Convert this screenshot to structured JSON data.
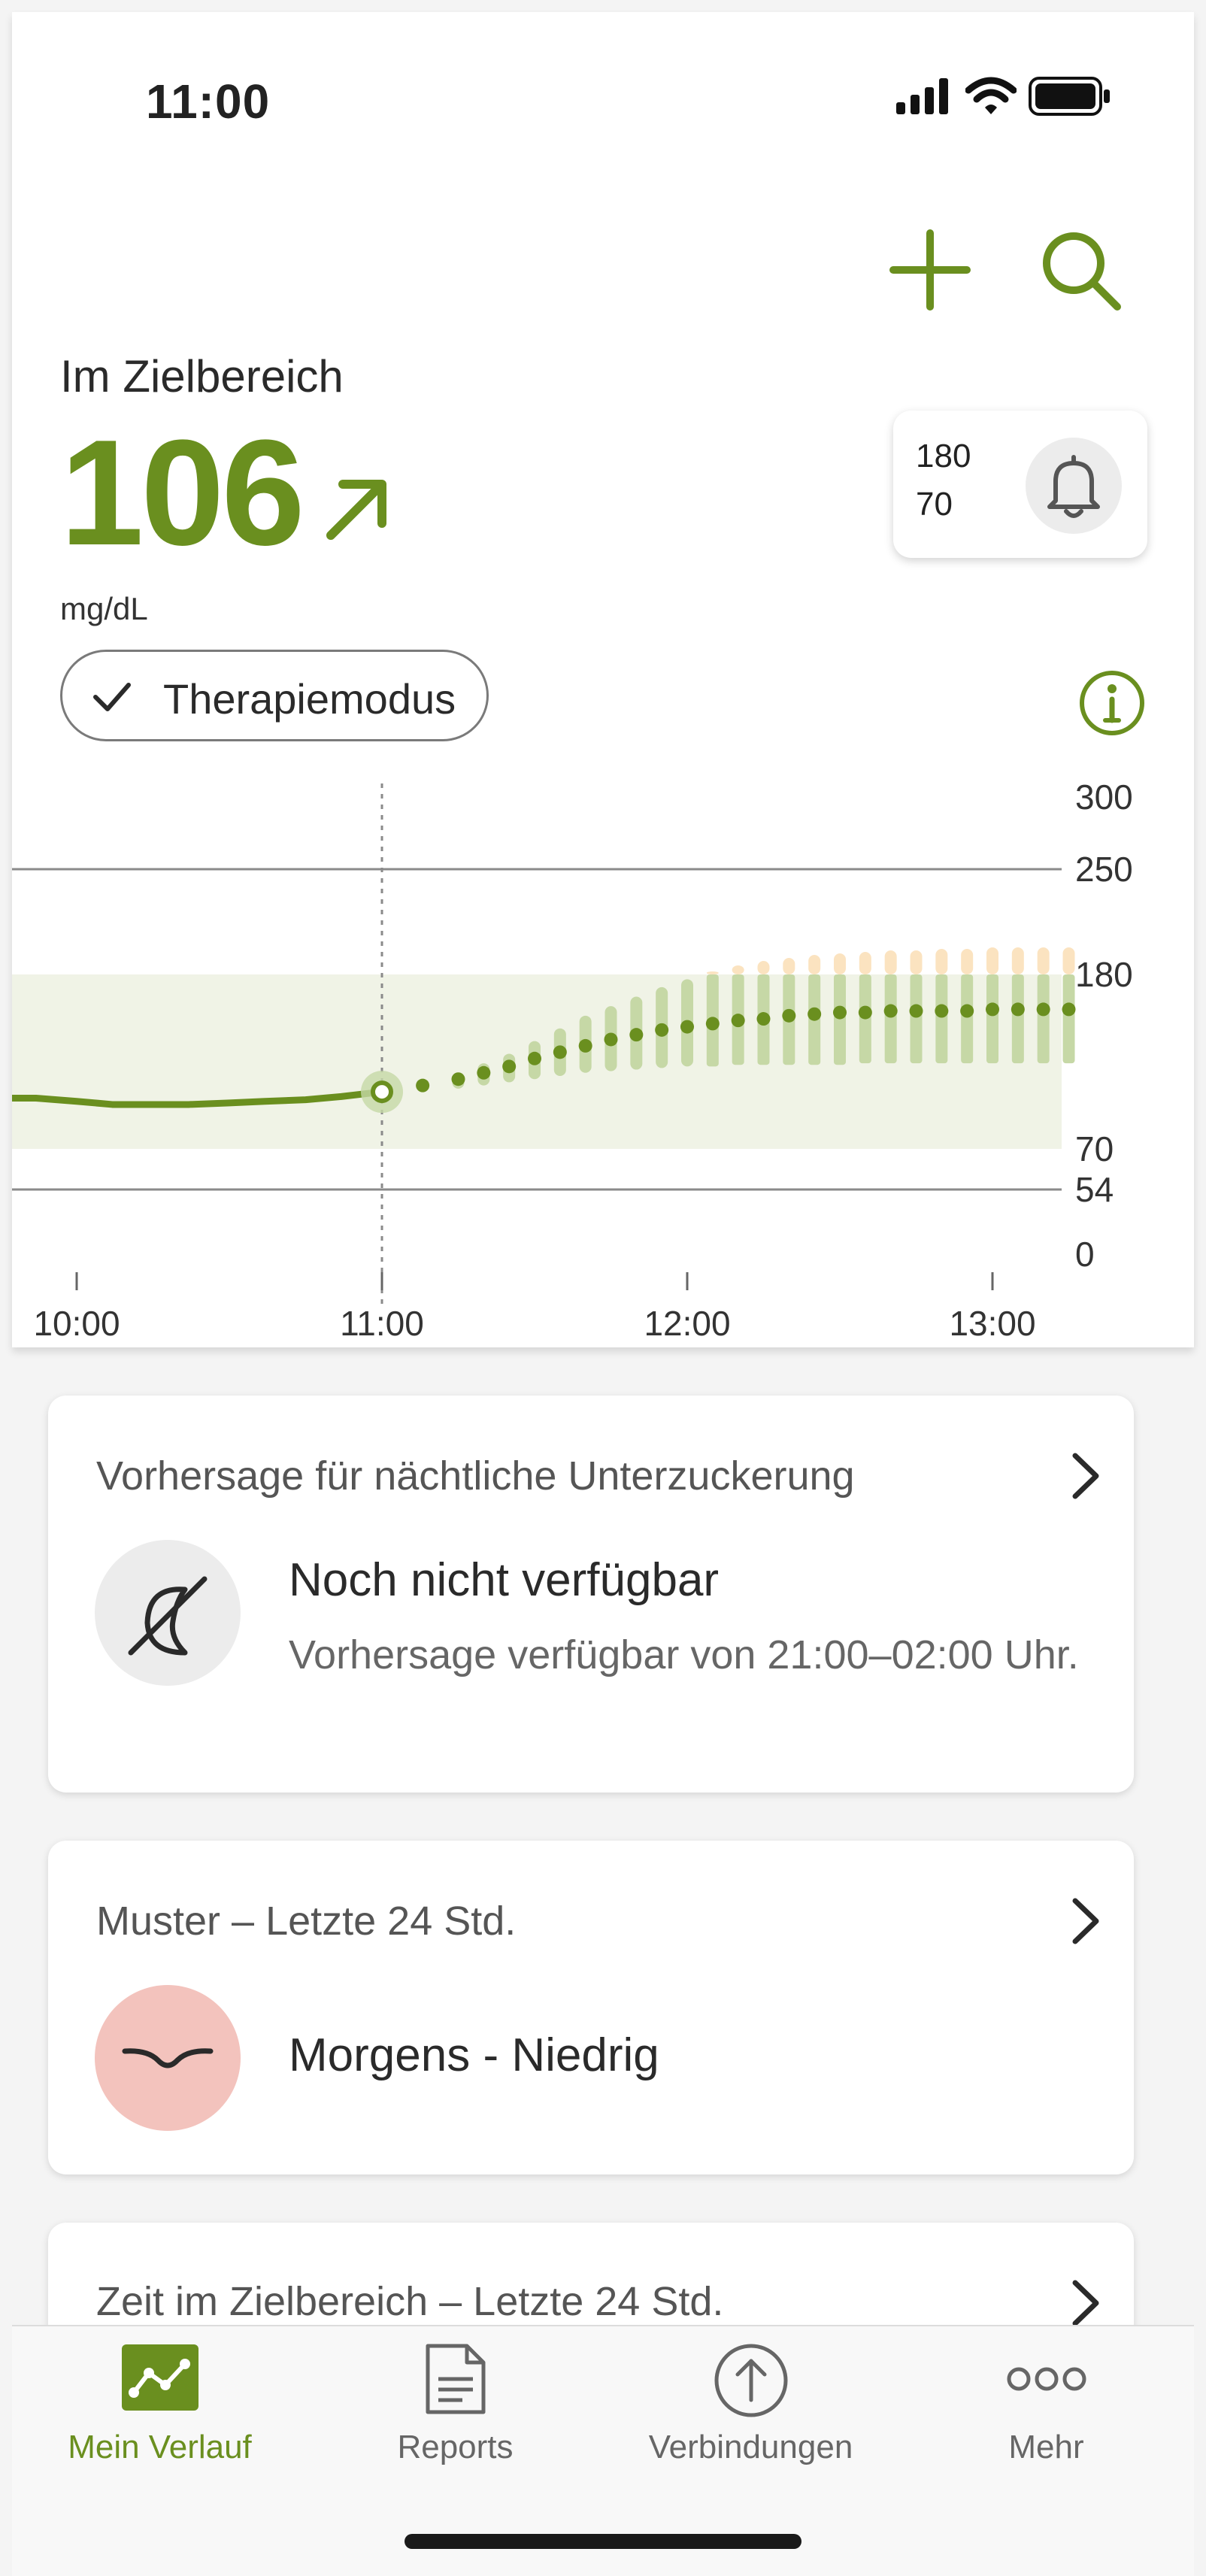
{
  "status_bar": {
    "time": "11:00"
  },
  "glucose": {
    "range_label": "Im Zielbereich",
    "value": "106",
    "unit": "mg/dL",
    "alarm_high": "180",
    "alarm_low": "70"
  },
  "mode": {
    "label": "Therapiemodus"
  },
  "colors": {
    "accent": "#6a8f1f",
    "target_band": "#f0f3e6",
    "prediction_band": "#c6d8a6",
    "prediction_high": "#fbe3c0",
    "pattern_badge": "#f3c3bd"
  },
  "chart_data": {
    "type": "line",
    "y_ticks": [
      "300",
      "250",
      "180",
      "70",
      "54",
      "0"
    ],
    "x_ticks": [
      "10:00",
      "11:00",
      "12:00",
      "13:00"
    ],
    "target_range": [
      70,
      180
    ],
    "reference_lines": [
      250,
      54
    ],
    "current_time": "11:00",
    "history": {
      "x": [
        "09:52",
        "10:00",
        "10:07",
        "10:15",
        "10:22",
        "10:30",
        "10:37",
        "10:45",
        "10:52",
        "11:00"
      ],
      "y": [
        102,
        100,
        98,
        98,
        98,
        99,
        100,
        101,
        103,
        106
      ]
    },
    "prediction": {
      "x": [
        "11:08",
        "11:15",
        "11:20",
        "11:25",
        "11:30",
        "11:35",
        "11:40",
        "11:45",
        "11:50",
        "11:55",
        "12:00",
        "12:05",
        "12:10",
        "12:15",
        "12:20",
        "12:25",
        "12:30",
        "12:35",
        "12:40",
        "12:45",
        "12:50",
        "12:55",
        "13:00",
        "13:05",
        "13:10",
        "13:15"
      ],
      "y": [
        110,
        114,
        118,
        122,
        127,
        131,
        135,
        139,
        142,
        145,
        147,
        149,
        151,
        152,
        154,
        155,
        156,
        156,
        157,
        157,
        157,
        157,
        158,
        158,
        158,
        158
      ],
      "band_low": [
        106,
        108,
        110,
        112,
        114,
        116,
        118,
        119,
        120,
        121,
        122,
        122,
        123,
        123,
        123,
        123,
        123,
        124,
        124,
        124,
        124,
        124,
        124,
        124,
        124,
        124
      ],
      "band_high": [
        112,
        118,
        124,
        130,
        138,
        146,
        154,
        160,
        166,
        172,
        177,
        182,
        186,
        189,
        191,
        193,
        194,
        195,
        196,
        196,
        197,
        197,
        198,
        198,
        198,
        198
      ]
    }
  },
  "cards": {
    "nocturnal": {
      "header": "Vorhersage für nächtliche Unterzuckerung",
      "title": "Noch nicht verfügbar",
      "subtitle": "Vorhersage verfügbar von 21:00–02:00 Uhr."
    },
    "pattern": {
      "header": "Muster – Letzte 24 Std.",
      "title": "Morgens - Niedrig"
    },
    "time_in_range": {
      "header": "Zeit im Zielbereich – Letzte 24 Std."
    }
  },
  "tabs": [
    {
      "label": "Mein Verlauf",
      "icon": "trend-chart-icon",
      "active": true
    },
    {
      "label": "Reports",
      "icon": "document-icon",
      "active": false
    },
    {
      "label": "Verbindungen",
      "icon": "upload-circle-icon",
      "active": false
    },
    {
      "label": "Mehr",
      "icon": "more-dots-icon",
      "active": false
    }
  ]
}
